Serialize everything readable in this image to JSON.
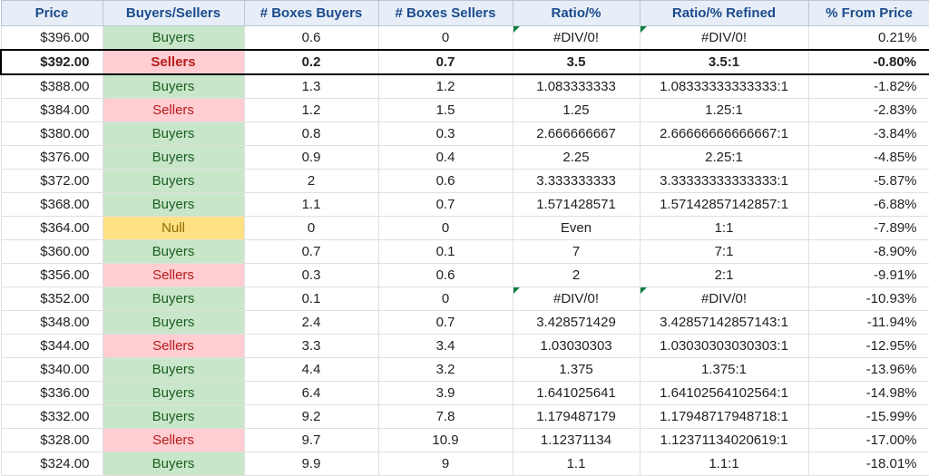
{
  "headers": {
    "price": "Price",
    "bs": "Buyers/Sellers",
    "buyers": "# Boxes Buyers",
    "sellers": "# Boxes Sellers",
    "ratio": "Ratio/%",
    "refined": "Ratio/% Refined",
    "pct": "% From Price"
  },
  "rows": [
    {
      "price": "$396.00",
      "bs": "Buyers",
      "buyers": "0.6",
      "sellers": "0",
      "ratio": "#DIV/0!",
      "ratio_err": true,
      "refined": "#DIV/0!",
      "refined_err": true,
      "pct": "0.21%",
      "highlight": false
    },
    {
      "price": "$392.00",
      "bs": "Sellers",
      "buyers": "0.2",
      "sellers": "0.7",
      "ratio": "3.5",
      "ratio_err": false,
      "refined": "3.5:1",
      "refined_err": false,
      "pct": "-0.80%",
      "highlight": true
    },
    {
      "price": "$388.00",
      "bs": "Buyers",
      "buyers": "1.3",
      "sellers": "1.2",
      "ratio": "1.083333333",
      "ratio_err": false,
      "refined": "1.08333333333333:1",
      "refined_err": false,
      "pct": "-1.82%",
      "highlight": false
    },
    {
      "price": "$384.00",
      "bs": "Sellers",
      "buyers": "1.2",
      "sellers": "1.5",
      "ratio": "1.25",
      "ratio_err": false,
      "refined": "1.25:1",
      "refined_err": false,
      "pct": "-2.83%",
      "highlight": false
    },
    {
      "price": "$380.00",
      "bs": "Buyers",
      "buyers": "0.8",
      "sellers": "0.3",
      "ratio": "2.666666667",
      "ratio_err": false,
      "refined": "2.66666666666667:1",
      "refined_err": false,
      "pct": "-3.84%",
      "highlight": false
    },
    {
      "price": "$376.00",
      "bs": "Buyers",
      "buyers": "0.9",
      "sellers": "0.4",
      "ratio": "2.25",
      "ratio_err": false,
      "refined": "2.25:1",
      "refined_err": false,
      "pct": "-4.85%",
      "highlight": false
    },
    {
      "price": "$372.00",
      "bs": "Buyers",
      "buyers": "2",
      "sellers": "0.6",
      "ratio": "3.333333333",
      "ratio_err": false,
      "refined": "3.33333333333333:1",
      "refined_err": false,
      "pct": "-5.87%",
      "highlight": false
    },
    {
      "price": "$368.00",
      "bs": "Buyers",
      "buyers": "1.1",
      "sellers": "0.7",
      "ratio": "1.571428571",
      "ratio_err": false,
      "refined": "1.57142857142857:1",
      "refined_err": false,
      "pct": "-6.88%",
      "highlight": false
    },
    {
      "price": "$364.00",
      "bs": "Null",
      "buyers": "0",
      "sellers": "0",
      "ratio": "Even",
      "ratio_err": false,
      "refined": "1:1",
      "refined_err": false,
      "pct": "-7.89%",
      "highlight": false
    },
    {
      "price": "$360.00",
      "bs": "Buyers",
      "buyers": "0.7",
      "sellers": "0.1",
      "ratio": "7",
      "ratio_err": false,
      "refined": "7:1",
      "refined_err": false,
      "pct": "-8.90%",
      "highlight": false
    },
    {
      "price": "$356.00",
      "bs": "Sellers",
      "buyers": "0.3",
      "sellers": "0.6",
      "ratio": "2",
      "ratio_err": false,
      "refined": "2:1",
      "refined_err": false,
      "pct": "-9.91%",
      "highlight": false
    },
    {
      "price": "$352.00",
      "bs": "Buyers",
      "buyers": "0.1",
      "sellers": "0",
      "ratio": "#DIV/0!",
      "ratio_err": true,
      "refined": "#DIV/0!",
      "refined_err": true,
      "pct": "-10.93%",
      "highlight": false
    },
    {
      "price": "$348.00",
      "bs": "Buyers",
      "buyers": "2.4",
      "sellers": "0.7",
      "ratio": "3.428571429",
      "ratio_err": false,
      "refined": "3.42857142857143:1",
      "refined_err": false,
      "pct": "-11.94%",
      "highlight": false
    },
    {
      "price": "$344.00",
      "bs": "Sellers",
      "buyers": "3.3",
      "sellers": "3.4",
      "ratio": "1.03030303",
      "ratio_err": false,
      "refined": "1.03030303030303:1",
      "refined_err": false,
      "pct": "-12.95%",
      "highlight": false
    },
    {
      "price": "$340.00",
      "bs": "Buyers",
      "buyers": "4.4",
      "sellers": "3.2",
      "ratio": "1.375",
      "ratio_err": false,
      "refined": "1.375:1",
      "refined_err": false,
      "pct": "-13.96%",
      "highlight": false
    },
    {
      "price": "$336.00",
      "bs": "Buyers",
      "buyers": "6.4",
      "sellers": "3.9",
      "ratio": "1.641025641",
      "ratio_err": false,
      "refined": "1.64102564102564:1",
      "refined_err": false,
      "pct": "-14.98%",
      "highlight": false
    },
    {
      "price": "$332.00",
      "bs": "Buyers",
      "buyers": "9.2",
      "sellers": "7.8",
      "ratio": "1.179487179",
      "ratio_err": false,
      "refined": "1.17948717948718:1",
      "refined_err": false,
      "pct": "-15.99%",
      "highlight": false
    },
    {
      "price": "$328.00",
      "bs": "Sellers",
      "buyers": "9.7",
      "sellers": "10.9",
      "ratio": "1.12371134",
      "ratio_err": false,
      "refined": "1.12371134020619:1",
      "refined_err": false,
      "pct": "-17.00%",
      "highlight": false
    },
    {
      "price": "$324.00",
      "bs": "Buyers",
      "buyers": "9.9",
      "sellers": "9",
      "ratio": "1.1",
      "ratio_err": false,
      "refined": "1.1:1",
      "refined_err": false,
      "pct": "-18.01%",
      "highlight": false
    }
  ]
}
